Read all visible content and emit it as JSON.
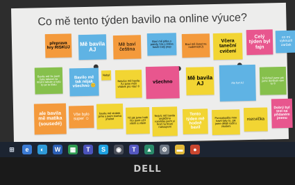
{
  "board": {
    "title": "Co mě tento týden bavilo na online výuce?",
    "notes": [
      "přeprava hry RISKUJ",
      "Mě bavila AJ",
      "Mě baví čeština",
      "Baví mě pitka o pandy, hra o kráva bavili Celý jnep",
      "Baví mě švest na nudimni(AJ)",
      "Včera taneční cvičení",
      "Celý týden byl fajn",
      "co mi vykouzlí zarůsk",
      "Bavilo mě že jsem byla taková na místní tabule a bylo to se to líbilo",
      "Bavilo mě tak nějak všechno 😊",
      "Nebyl",
      "Nejvíce mě bavila AJ jsme měli vtrátek pro nás! ©",
      "všechno",
      "Mě bavila AJ",
      "Ale furt AJ",
      "S těchož jsme jak jsme donikali nám to ©",
      "ale bavila mě matika (sousedé)",
      "Vše bylo super ☺",
      "bavila mě vtrátek jsme s jsem tvorba jmelné",
      "Tě jak jsme hráli hry jsem užíl vtiem a vtiem",
      "Nejvíc mě bavila angličtina rozehlas jsem si hrať na hraní nakoupeni",
      "Tento týden mě hodně bavil",
      "Ponsaloudila mne bavil taky to, jak jsme dělali radit s zkušeni",
      "rozcvička",
      "Dobrý byl test na přidaném jmenu"
    ]
  },
  "taskbar": {
    "apps": [
      "windows-logo",
      "edge-browser",
      "edge",
      "word",
      "spreadsheet",
      "teams",
      "skype",
      "chrome",
      "teams-2",
      "photos",
      "settings",
      "file-explorer",
      "media"
    ]
  },
  "bezel": {
    "brand": "DELL"
  },
  "colors": {
    "yellow": "#f2d533",
    "blue": "#5fb3e4",
    "orange": "#f49a3c",
    "pink": "#e8568e",
    "green": "#86c04c",
    "screen": "#ededec",
    "taskbar": "#1c2431"
  }
}
